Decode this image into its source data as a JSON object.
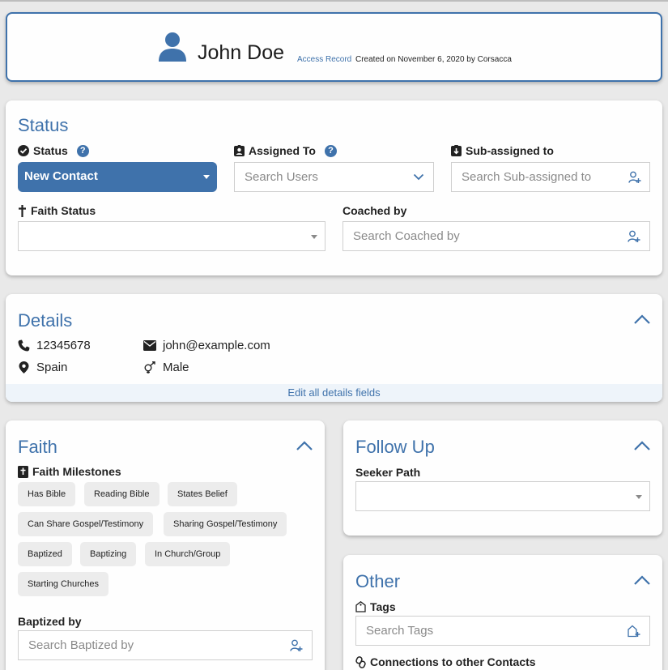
{
  "header": {
    "name": "John Doe",
    "access_record": "Access Record",
    "created": "Created on November 6, 2020 by Corsacca"
  },
  "status_section": {
    "title": "Status",
    "status_label": "Status",
    "status_value": "New Contact",
    "assigned_label": "Assigned To",
    "assigned_placeholder": "Search Users",
    "subassigned_label": "Sub-assigned to",
    "subassigned_placeholder": "Search Sub-assigned to",
    "faith_status_label": "Faith Status",
    "faith_status_value": "",
    "coached_label": "Coached by",
    "coached_placeholder": "Search Coached by",
    "help_glyph": "?"
  },
  "details": {
    "title": "Details",
    "phone": "12345678",
    "email": "john@example.com",
    "location": "Spain",
    "gender": "Male",
    "edit_all": "Edit all details fields"
  },
  "faith": {
    "title": "Faith",
    "milestones_label": "Faith Milestones",
    "milestones": [
      "Has Bible",
      "Reading Bible",
      "States Belief",
      "Can Share Gospel/Testimony",
      "Sharing Gospel/Testimony",
      "Baptized",
      "Baptizing",
      "In Church/Group",
      "Starting Churches"
    ],
    "baptized_label": "Baptized by",
    "baptized_placeholder": "Search Baptized by"
  },
  "follow_up": {
    "title": "Follow Up",
    "seeker_label": "Seeker Path",
    "seeker_value": ""
  },
  "other": {
    "title": "Other",
    "tags_label": "Tags",
    "tags_placeholder": "Search Tags",
    "connections_label": "Connections to other Contacts"
  },
  "colors": {
    "accent": "#3f72ab",
    "background": "#e9e9e9",
    "card": "#fefefe"
  }
}
